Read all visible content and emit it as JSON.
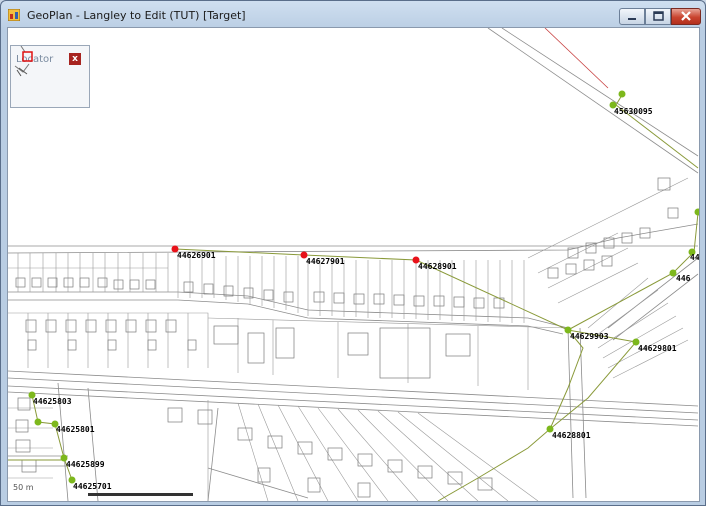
{
  "window": {
    "title": "GeoPlan - Langley to Edit (TUT) [Target]",
    "buttons": {
      "minimize": "minimize",
      "maximize": "maximize",
      "close": "close"
    }
  },
  "locator": {
    "title": "Locator",
    "close_label": "x"
  },
  "scale": {
    "label": "50 m"
  },
  "colors": {
    "selected_node": "#e8121a",
    "node": "#7db81c",
    "pipe": "#8a9a3a",
    "buildings": "#8c8c8c",
    "map_bg": "#ffffff"
  },
  "nodes": {
    "n1": "45630095",
    "n2": "44626901",
    "n3": "44627901",
    "n4": "44628901",
    "n5": "44629903",
    "n6": "44629801",
    "n7": "44625803",
    "n8": "44625801",
    "n9": "44625899",
    "n10": "44625701",
    "n11": "44628801",
    "n12": "446",
    "n13": "44"
  }
}
